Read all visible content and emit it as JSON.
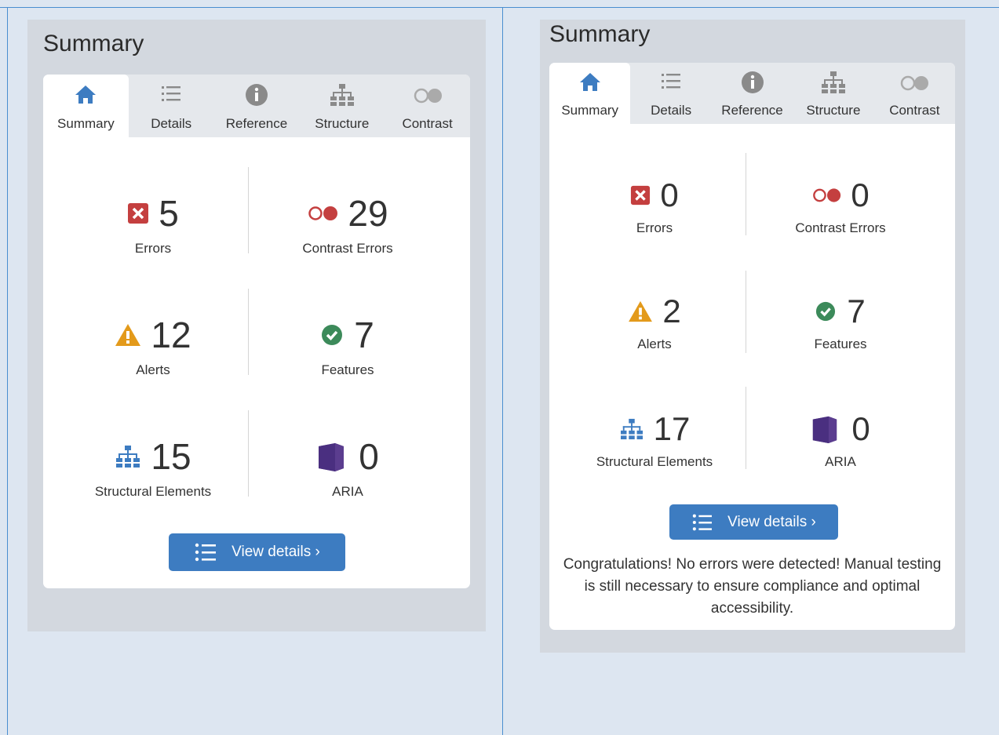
{
  "colors": {
    "page_bg": "#dde6f1",
    "panel_bg": "#d3d8df",
    "accent": "#3d7cc1",
    "error": "#c43f3f",
    "alert": "#e39a1b",
    "feature": "#3c8a5a",
    "structure": "#3d7cc1",
    "aria": "#5b3d8f"
  },
  "left": {
    "title": "Summary",
    "tabs": [
      {
        "label": "Summary",
        "icon": "home-icon",
        "active": true
      },
      {
        "label": "Details",
        "icon": "list-icon",
        "active": false
      },
      {
        "label": "Reference",
        "icon": "info-icon",
        "active": false
      },
      {
        "label": "Structure",
        "icon": "structure-icon",
        "active": false
      },
      {
        "label": "Contrast",
        "icon": "contrast-icon",
        "active": false
      }
    ],
    "stats": {
      "errors": {
        "value": "5",
        "label": "Errors",
        "icon": "error-icon"
      },
      "contrast": {
        "value": "29",
        "label": "Contrast Errors",
        "icon": "contrast-error-icon"
      },
      "alerts": {
        "value": "12",
        "label": "Alerts",
        "icon": "alert-icon"
      },
      "features": {
        "value": "7",
        "label": "Features",
        "icon": "feature-check-icon"
      },
      "structure": {
        "value": "15",
        "label": "Structural Elements",
        "icon": "structure-icon"
      },
      "aria": {
        "value": "0",
        "label": "ARIA",
        "icon": "aria-cube-icon"
      }
    },
    "button_label": "View details ›"
  },
  "right": {
    "title": "Summary",
    "tabs": [
      {
        "label": "Summary",
        "icon": "home-icon",
        "active": true
      },
      {
        "label": "Details",
        "icon": "list-icon",
        "active": false
      },
      {
        "label": "Reference",
        "icon": "info-icon",
        "active": false
      },
      {
        "label": "Structure",
        "icon": "structure-icon",
        "active": false
      },
      {
        "label": "Contrast",
        "icon": "contrast-icon",
        "active": false
      }
    ],
    "stats": {
      "errors": {
        "value": "0",
        "label": "Errors",
        "icon": "error-icon"
      },
      "contrast": {
        "value": "0",
        "label": "Contrast Errors",
        "icon": "contrast-error-icon"
      },
      "alerts": {
        "value": "2",
        "label": "Alerts",
        "icon": "alert-icon"
      },
      "features": {
        "value": "7",
        "label": "Features",
        "icon": "feature-check-icon"
      },
      "structure": {
        "value": "17",
        "label": "Structural Elements",
        "icon": "structure-icon"
      },
      "aria": {
        "value": "0",
        "label": "ARIA",
        "icon": "aria-cube-icon"
      }
    },
    "button_label": "View details ›",
    "message": "Congratulations! No errors were detected! Manual testing is still necessary to ensure compliance and optimal accessibility."
  }
}
